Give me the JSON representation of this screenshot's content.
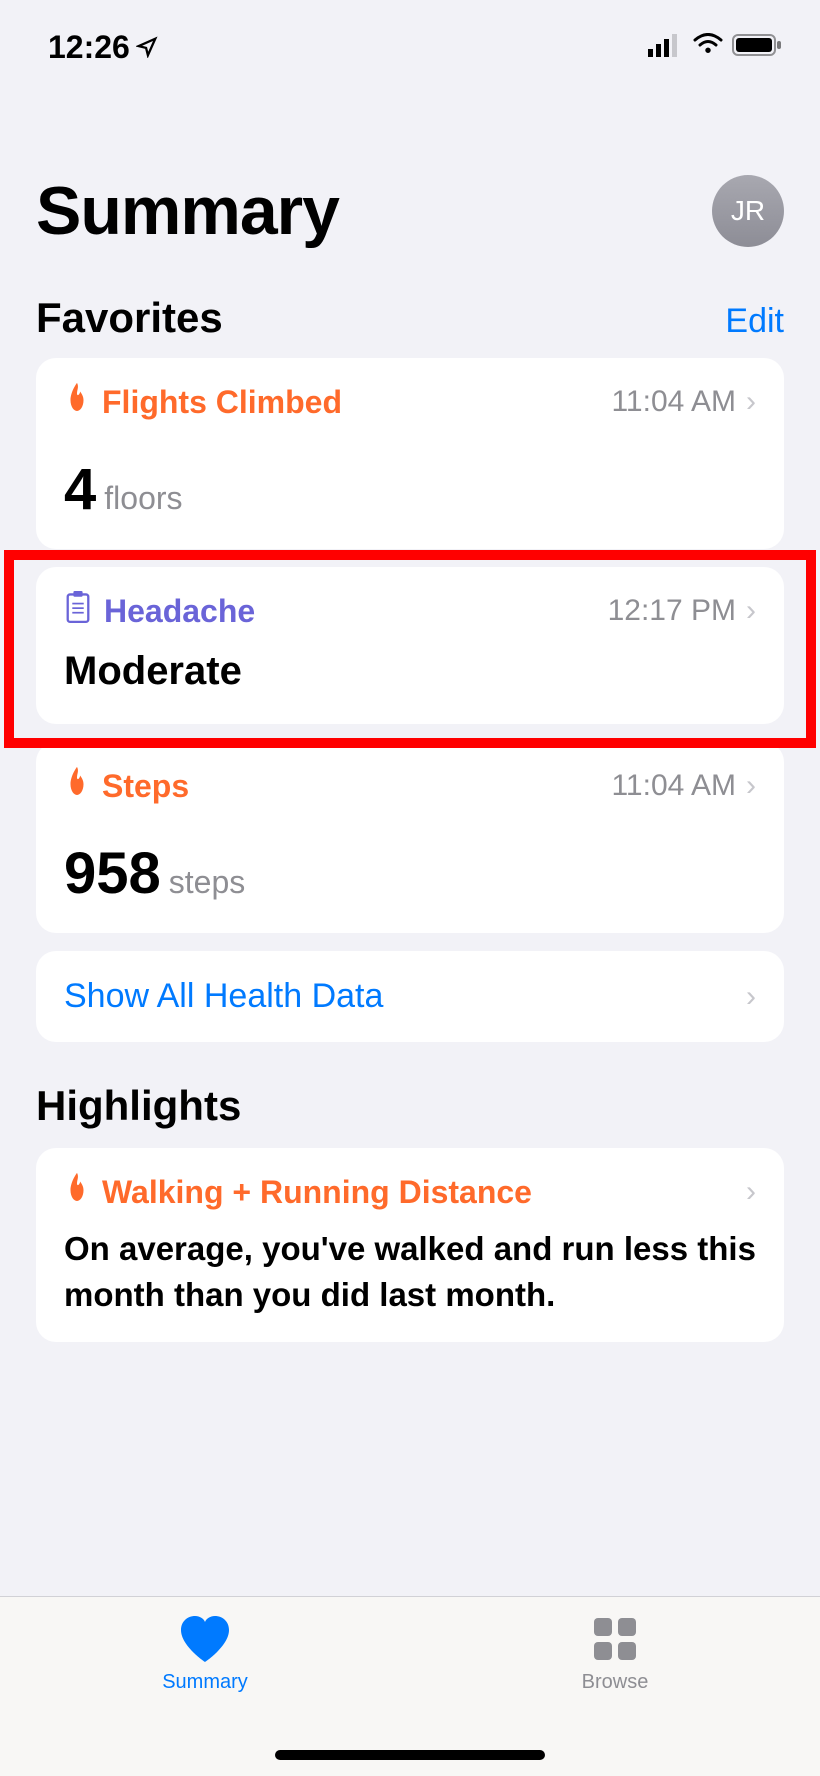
{
  "status": {
    "time": "12:26"
  },
  "header": {
    "title": "Summary",
    "avatar": "JR"
  },
  "favorites": {
    "title": "Favorites",
    "edit": "Edit",
    "items": [
      {
        "label": "Flights Climbed",
        "time": "11:04 AM",
        "value": "4",
        "unit": "floors"
      },
      {
        "label": "Headache",
        "time": "12:17 PM",
        "value_text": "Moderate"
      },
      {
        "label": "Steps",
        "time": "11:04 AM",
        "value": "958",
        "unit": "steps"
      }
    ],
    "show_all": "Show All Health Data"
  },
  "highlights": {
    "title": "Highlights",
    "item": {
      "label": "Walking + Running Distance",
      "text": "On average, you've walked and run less this month than you did last month."
    }
  },
  "tabs": {
    "summary": "Summary",
    "browse": "Browse"
  }
}
